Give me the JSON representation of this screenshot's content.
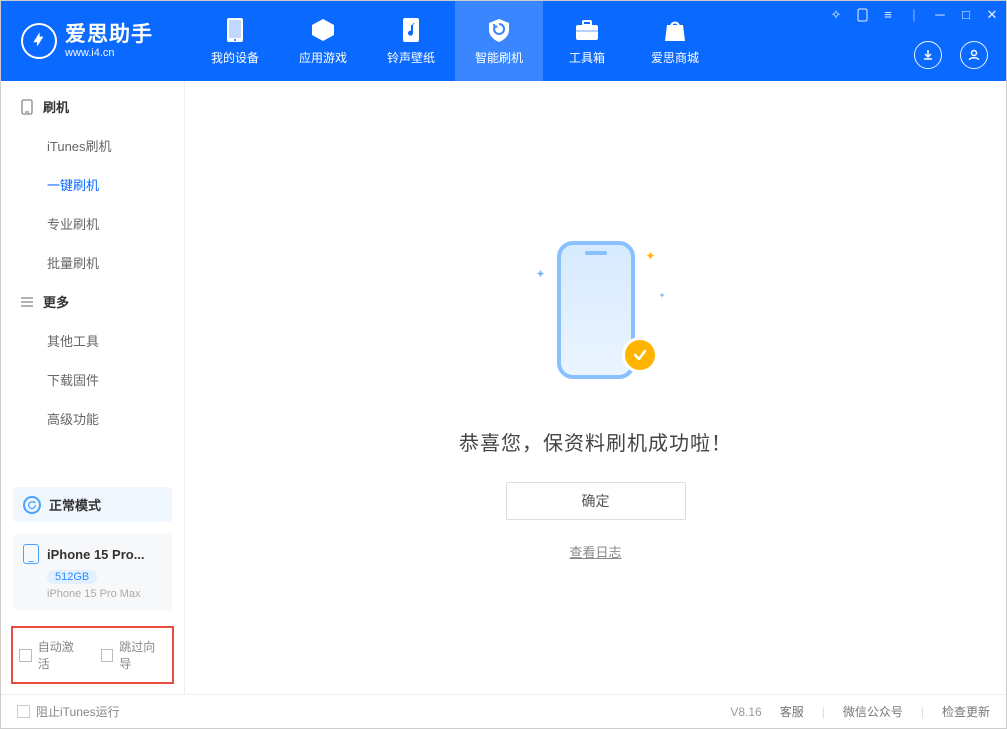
{
  "app": {
    "title": "爱思助手",
    "subtitle": "www.i4.cn"
  },
  "nav": {
    "items": [
      {
        "label": "我的设备"
      },
      {
        "label": "应用游戏"
      },
      {
        "label": "铃声壁纸"
      },
      {
        "label": "智能刷机"
      },
      {
        "label": "工具箱"
      },
      {
        "label": "爱思商城"
      }
    ]
  },
  "sidebar": {
    "sections": [
      {
        "header": "刷机",
        "items": [
          {
            "label": "iTunes刷机"
          },
          {
            "label": "一键刷机"
          },
          {
            "label": "专业刷机"
          },
          {
            "label": "批量刷机"
          }
        ]
      },
      {
        "header": "更多",
        "items": [
          {
            "label": "其他工具"
          },
          {
            "label": "下载固件"
          },
          {
            "label": "高级功能"
          }
        ]
      }
    ],
    "status": {
      "label": "正常模式"
    },
    "device": {
      "name": "iPhone 15 Pro...",
      "storage": "512GB",
      "model": "iPhone 15 Pro Max"
    },
    "options": {
      "auto_activate": "自动激活",
      "skip_wizard": "跳过向导"
    }
  },
  "main": {
    "success_msg": "恭喜您，保资料刷机成功啦！",
    "ok_label": "确定",
    "log_link": "查看日志"
  },
  "footer": {
    "block_itunes": "阻止iTunes运行",
    "version": "V8.16",
    "links": {
      "support": "客服",
      "wechat": "微信公众号",
      "update": "检查更新"
    }
  }
}
